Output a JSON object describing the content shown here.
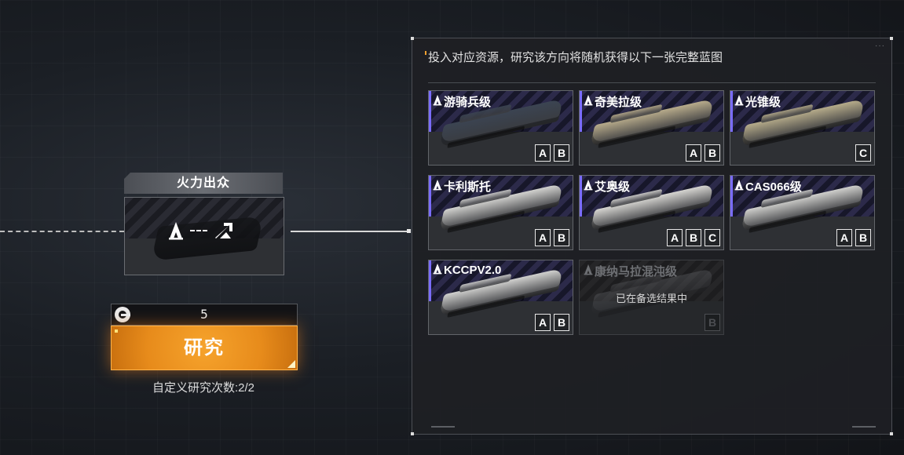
{
  "node": {
    "title": "火力出众"
  },
  "research": {
    "count": "5",
    "button_label": "研究",
    "custom_count": "自定义研究次数:2/2"
  },
  "panel": {
    "hint": "投入对应资源，研究该方向将随机获得以下一张完整蓝图",
    "blueprints": [
      {
        "name": "游骑兵级",
        "tags": [
          "A",
          "B"
        ],
        "ship_color": "#3b4452",
        "disabled": false
      },
      {
        "name": "奇美拉级",
        "tags": [
          "A",
          "B"
        ],
        "ship_color": "#b7ab8b",
        "disabled": false
      },
      {
        "name": "光锥级",
        "tags": [
          "C"
        ],
        "ship_color": "#b5ab8a",
        "disabled": false
      },
      {
        "name": "卡利斯托",
        "tags": [
          "A",
          "B"
        ],
        "ship_color": "#d2d2cf",
        "disabled": false
      },
      {
        "name": "艾奥级",
        "tags": [
          "A",
          "B",
          "C"
        ],
        "ship_color": "#d6d5d1",
        "disabled": false
      },
      {
        "name": "CAS066级",
        "tags": [
          "A",
          "B"
        ],
        "ship_color": "#cfcfcc",
        "disabled": false
      },
      {
        "name": "KCCPV2.0",
        "tags": [
          "A",
          "B"
        ],
        "ship_color": "#d0d0ce",
        "disabled": false
      },
      {
        "name": "康纳马拉混沌级",
        "tags": [
          "B"
        ],
        "ship_color": "#6a6c70",
        "disabled": true,
        "overlay": "已在备选结果中"
      }
    ]
  },
  "colors": {
    "accent_orange": "#e78b1b",
    "stripe_purple": "#2c2a4a",
    "tag_border": "#e8e8e8"
  },
  "icons": {
    "node_left": "pilot-delta-icon",
    "node_right": "rank-up-arrow-icon",
    "count": "currency-token-icon",
    "blueprint_prefix": "pilot-delta-icon"
  }
}
